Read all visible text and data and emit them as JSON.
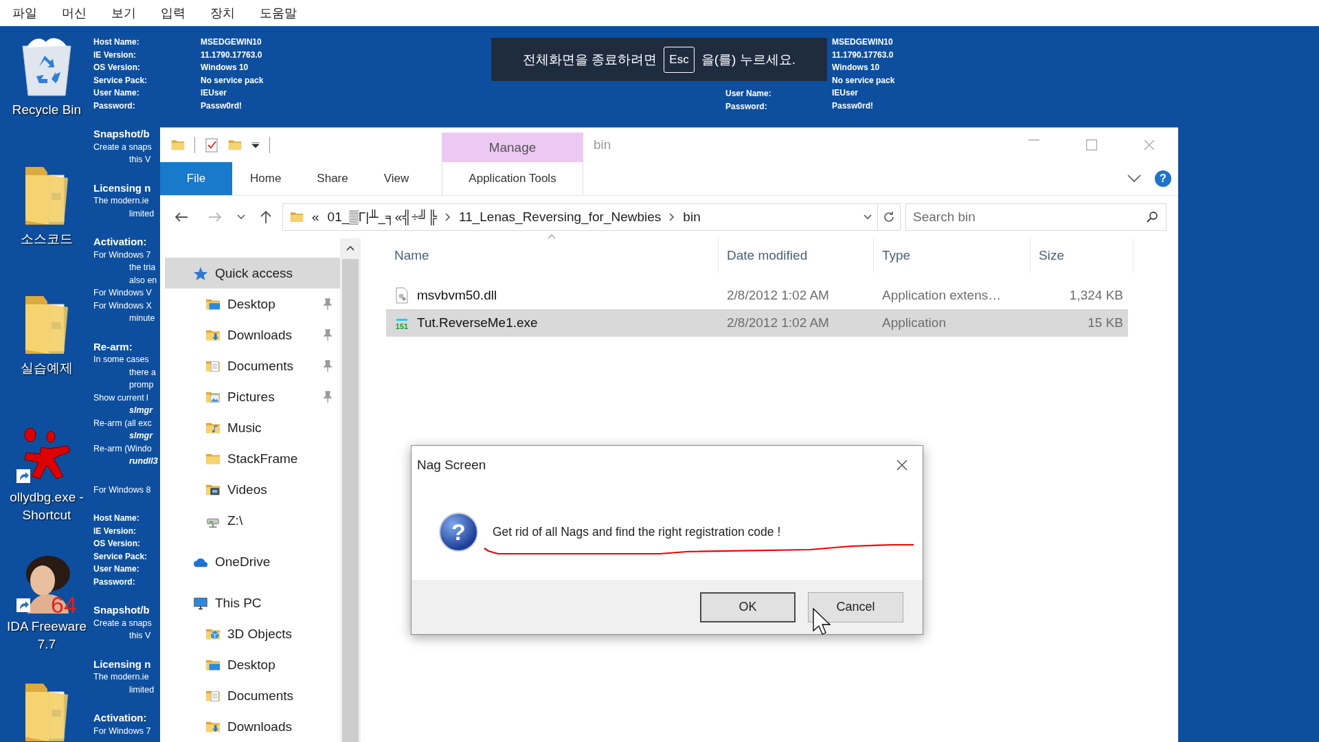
{
  "menu_bar": [
    "파일",
    "머신",
    "보기",
    "입력",
    "장치",
    "도움말"
  ],
  "desktop_icons": [
    {
      "kind": "recycle-bin",
      "label": "Recycle Bin"
    },
    {
      "kind": "folder",
      "label": "소스코드"
    },
    {
      "kind": "folder",
      "label": "실습예제"
    },
    {
      "kind": "splat-shortcut",
      "label": "ollydbg.exe - Shortcut"
    },
    {
      "kind": "figure-shortcut",
      "label": "IDA Freeware 7.7",
      "badge": "64"
    },
    {
      "kind": "folder"
    }
  ],
  "info_left": [
    {
      "lines": [
        {
          "kind": "field",
          "label": "Host Name:",
          "value": "MSEDGEWIN10"
        },
        {
          "kind": "field",
          "label": "IE Version:",
          "value": "11.1790.17763.0"
        },
        {
          "kind": "field",
          "label": "OS Version:",
          "value": "Windows 10"
        },
        {
          "kind": "field",
          "label": "Service Pack:",
          "value": "No service pack"
        },
        {
          "kind": "field",
          "label": "User Name:",
          "value": "IEUser"
        },
        {
          "kind": "field",
          "label": "Password:",
          "value": "Passw0rd!"
        }
      ]
    },
    {
      "lines": [
        {
          "kind": "heading",
          "text": "Snapshot/b"
        },
        {
          "kind": "text",
          "text": "Create a snaps"
        },
        {
          "kind": "indent",
          "text": "this V"
        }
      ]
    },
    {
      "lines": [
        {
          "kind": "heading",
          "text": "Licensing n"
        },
        {
          "kind": "text",
          "text": "The modern.ie"
        },
        {
          "kind": "indent",
          "text": "limited"
        }
      ]
    },
    {
      "lines": [
        {
          "kind": "heading",
          "text": "Activation:"
        },
        {
          "kind": "text",
          "text": "For Windows 7"
        },
        {
          "kind": "indent",
          "text": "the tria"
        },
        {
          "kind": "indent",
          "text": "also en"
        },
        {
          "kind": "text",
          "text": "For Windows V"
        },
        {
          "kind": "text",
          "text": "For Windows X"
        },
        {
          "kind": "indent",
          "text": "minute"
        }
      ]
    },
    {
      "lines": [
        {
          "kind": "heading",
          "text": "Re-arm:"
        },
        {
          "kind": "text",
          "text": "In some cases"
        },
        {
          "kind": "indent",
          "text": "there a"
        },
        {
          "kind": "indent",
          "text": "promp"
        },
        {
          "kind": "text",
          "text": "Show current l"
        },
        {
          "kind": "command",
          "text": "slmgr"
        },
        {
          "kind": "text",
          "text": "Re-arm (all exc"
        },
        {
          "kind": "command",
          "text": "slmgr"
        },
        {
          "kind": "text",
          "text": "Re-arm (Windo"
        },
        {
          "kind": "command",
          "text": "rundll3"
        }
      ]
    },
    {
      "lines": [
        {
          "kind": "text",
          "text": "For Windows 8"
        }
      ]
    },
    {
      "lines": [
        {
          "kind": "field",
          "label": "Host Name:"
        },
        {
          "kind": "field",
          "label": "IE Version:"
        },
        {
          "kind": "field",
          "label": "OS Version:"
        },
        {
          "kind": "field",
          "label": "Service Pack:"
        },
        {
          "kind": "field",
          "label": "User Name:"
        },
        {
          "kind": "field",
          "label": "Password:"
        }
      ]
    },
    {
      "lines": [
        {
          "kind": "heading",
          "text": "Snapshot/b"
        },
        {
          "kind": "text",
          "text": "Create a snaps"
        },
        {
          "kind": "indent",
          "text": "this V"
        }
      ]
    },
    {
      "lines": [
        {
          "kind": "heading",
          "text": "Licensing n"
        },
        {
          "kind": "text",
          "text": "The modern.ie"
        },
        {
          "kind": "indent",
          "text": "limited"
        }
      ]
    },
    {
      "lines": [
        {
          "kind": "heading",
          "text": "Activation:"
        },
        {
          "kind": "text",
          "text": "For Windows 7"
        }
      ]
    }
  ],
  "info_right": [
    {
      "value": "MSEDGEWIN10"
    },
    {
      "value": "11.1790.17763.0"
    },
    {
      "value": "Windows 10"
    },
    {
      "value": "No service pack"
    },
    {
      "label": "User Name:",
      "value": "IEUser"
    },
    {
      "label": "Password:",
      "value": "Passw0rd!"
    }
  ],
  "fullscreen_notice": {
    "before": "전체화면을 종료하려면",
    "key": "Esc",
    "after": "을(를) 누르세요."
  },
  "explorer": {
    "title": "bin",
    "contextual_header": "Manage",
    "ribbon_tabs": [
      {
        "label": "File",
        "kind": "file"
      },
      {
        "label": "Home",
        "kind": "tab"
      },
      {
        "label": "Share",
        "kind": "tab"
      },
      {
        "label": "View",
        "kind": "tab"
      },
      {
        "label": "Application Tools",
        "kind": "contextual"
      }
    ],
    "help_glyph": "?",
    "address": {
      "overflow_mark": "«",
      "segments": [
        "01_▒Γ|╨_╕«╣÷╝╠",
        "11_Lenas_Reversing_for_Newbies",
        "bin"
      ]
    },
    "search": {
      "placeholder": "Search bin"
    },
    "navigation": [
      {
        "label": "Quick access",
        "kind": "star",
        "selected": true,
        "children": [
          {
            "label": "Desktop",
            "kind": "desktop",
            "pinned": true,
            "selected": false
          },
          {
            "label": "Downloads",
            "kind": "downloads",
            "pinned": true,
            "selected": false
          },
          {
            "label": "Documents",
            "kind": "documents",
            "pinned": true,
            "selected": false
          },
          {
            "label": "Pictures",
            "kind": "pictures",
            "pinned": true,
            "selected": false
          },
          {
            "label": "Music",
            "kind": "music",
            "pinned": false,
            "selected": false
          },
          {
            "label": "StackFrame",
            "kind": "folder",
            "pinned": false,
            "selected": false
          },
          {
            "label": "Videos",
            "kind": "videos",
            "pinned": false,
            "selected": false
          },
          {
            "label": "Z:\\",
            "kind": "network-drive",
            "pinned": false,
            "selected": false
          }
        ]
      },
      {
        "label": "OneDrive",
        "kind": "cloud",
        "selected": false
      },
      {
        "label": "This PC",
        "kind": "computer",
        "selected": false,
        "children": [
          {
            "label": "3D Objects",
            "kind": "objects",
            "pinned": false,
            "selected": false
          },
          {
            "label": "Desktop",
            "kind": "desktop",
            "pinned": false,
            "selected": false
          },
          {
            "label": "Documents",
            "kind": "documents",
            "pinned": false,
            "selected": false
          },
          {
            "label": "Downloads",
            "kind": "downloads",
            "pinned": false,
            "selected": false
          }
        ]
      }
    ],
    "columns": [
      "Name",
      "Date modified",
      "Type",
      "Size"
    ],
    "files": [
      {
        "name": "msvbvm50.dll",
        "kind": "dll",
        "date_modified": "2/8/2012 1:02 AM",
        "type": "Application extens…",
        "size": "1,324 KB",
        "selected": false
      },
      {
        "name": "Tut.ReverseMe1.exe",
        "kind": "exe",
        "icon_text": "151",
        "date_modified": "2/8/2012 1:02 AM",
        "type": "Application",
        "size": "15 KB",
        "selected": true
      }
    ]
  },
  "dialog": {
    "title": "Nag Screen",
    "icon_glyph": "?",
    "message": "Get rid of all Nags and find the right registration code !",
    "buttons": [
      {
        "label": "OK",
        "kind": "default"
      },
      {
        "label": "Cancel",
        "kind": "normal"
      }
    ]
  }
}
